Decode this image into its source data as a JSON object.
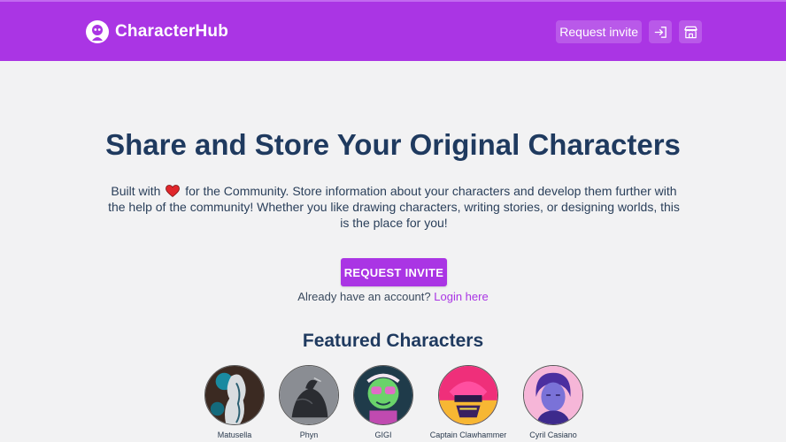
{
  "header": {
    "brand": "CharacterHub",
    "request_invite_label": "Request invite",
    "icons": [
      "login-icon",
      "store-icon"
    ],
    "colors": {
      "brand": "#aa35e4"
    }
  },
  "hero": {
    "title": "Share and Store Your Original Characters",
    "text_before_heart": "Built with",
    "text_after_heart": "for the Community. Store information about your characters and develop them further with the help of the community! Whether you like drawing characters, writing stories, or designing worlds, this is the place for you!",
    "cta_label": "REQUEST INVITE",
    "login_prompt": "Already have an account?",
    "login_link": "Login here"
  },
  "featured": {
    "title": "Featured Characters",
    "characters": [
      {
        "name": "Matusella"
      },
      {
        "name": "Phyn"
      },
      {
        "name": "GIGI"
      },
      {
        "name": "Captain Clawhammer"
      },
      {
        "name": "Cyril Casiano"
      }
    ]
  }
}
